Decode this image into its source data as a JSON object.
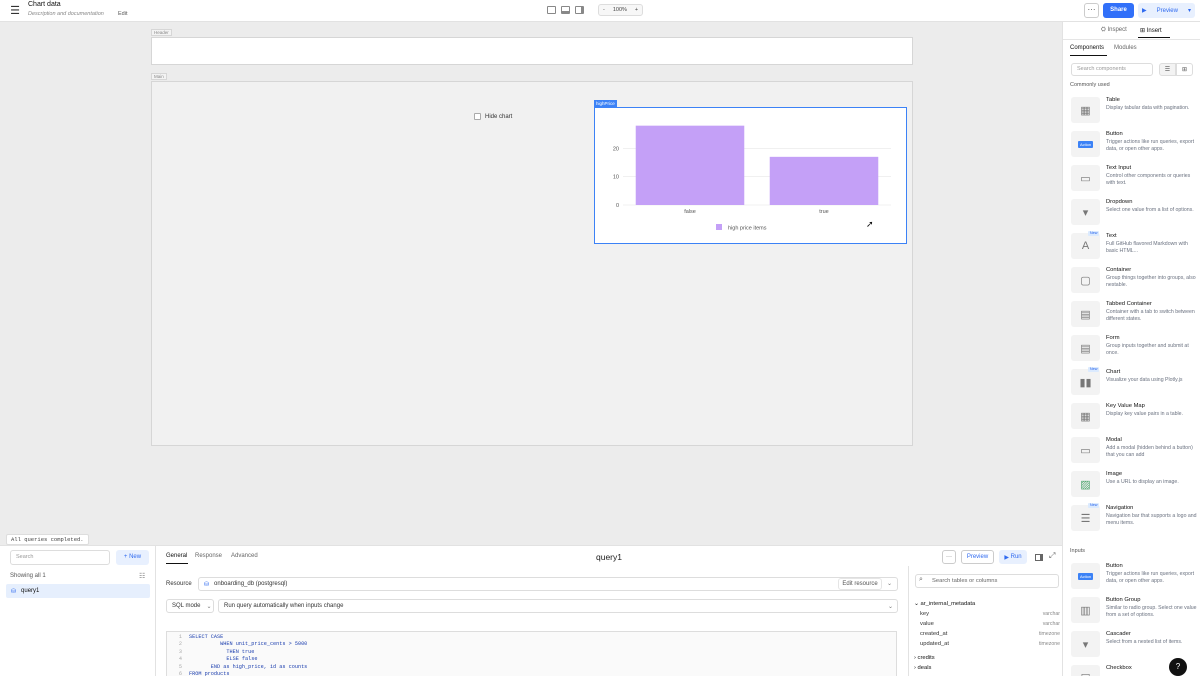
{
  "header": {
    "title": "Chart data",
    "subtitle": "Description and documentation",
    "edit_label": "Edit",
    "zoom": "100%",
    "zoom_minus": "-",
    "zoom_plus": "+",
    "more": "···",
    "share": "Share",
    "preview": "Preview"
  },
  "canvas": {
    "header_tag": "Header",
    "main_tag": "Main",
    "hide_chart_label": "Hide chart",
    "chart_component_tag": "highPrice"
  },
  "chart_data": {
    "type": "bar",
    "categories": [
      "false",
      "true"
    ],
    "series": [
      {
        "name": "high price items",
        "values": [
          28,
          17
        ]
      }
    ],
    "yticks": [
      0,
      10,
      20
    ],
    "ylim": [
      0,
      30
    ],
    "bar_color": "#c4a0f7",
    "grid": true,
    "legend": "bottom"
  },
  "status": "All queries completed.",
  "query_panel": {
    "search_placeholder": "Search",
    "new_label": "+ New",
    "showing": "Showing all 1",
    "queries": [
      "query1"
    ],
    "tabs": [
      "General",
      "Response",
      "Advanced"
    ],
    "query_name": "query1",
    "more": "···",
    "preview": "Preview",
    "run": "Run",
    "resource_label": "Resource",
    "resource_value": "onboarding_db (postgresql)",
    "edit_resource": "Edit resource",
    "mode": "SQL mode",
    "run_mode": "Run query automatically when inputs change",
    "line_numbers": [
      "1",
      "2",
      "3",
      "4",
      "5",
      "6"
    ],
    "code": "SELECT CASE\n          WHEN unit_price_cents > 5000\n            THEN true\n            ELSE false\n       END as high_price, id as counts\nFROM products"
  },
  "schema": {
    "search_placeholder": "Search tables or columns",
    "table": "ar_internal_metadata",
    "columns": [
      {
        "name": "key",
        "type": "varchar"
      },
      {
        "name": "value",
        "type": "varchar"
      },
      {
        "name": "created_at",
        "type": "timezone"
      },
      {
        "name": "updated_at",
        "type": "timezone"
      }
    ],
    "other_tables": [
      "credits",
      "deals"
    ]
  },
  "right_panel": {
    "tab_inspect": "Inspect",
    "tab_insert": "Insert",
    "sub_components": "Components",
    "sub_modules": "Modules",
    "search_placeholder": "Search components",
    "commonly_used": "Commonly used",
    "inputs_label": "Inputs",
    "new_badge": "New",
    "components": [
      {
        "name": "Table",
        "desc": "Display tabular data with pagination."
      },
      {
        "name": "Button",
        "desc": "Trigger actions like run queries, export data, or open other apps."
      },
      {
        "name": "Text Input",
        "desc": "Control other components or queries with text."
      },
      {
        "name": "Dropdown",
        "desc": "Select one value from a list of options."
      },
      {
        "name": "Text",
        "desc": "Full GitHub flavored Markdown with basic HTML..."
      },
      {
        "name": "Container",
        "desc": "Group things together into groups, also nestable."
      },
      {
        "name": "Tabbed Container",
        "desc": "Container with a tab to switch between different states."
      },
      {
        "name": "Form",
        "desc": "Group inputs together and submit at once."
      },
      {
        "name": "Chart",
        "desc": "Visualize your data using Plotly.js"
      },
      {
        "name": "Key Value Map",
        "desc": "Display key value pairs in a table."
      },
      {
        "name": "Modal",
        "desc": "Add a modal (hidden behind a button) that you can add"
      },
      {
        "name": "Image",
        "desc": "Use a URL to display an image."
      },
      {
        "name": "Navigation",
        "desc": "Navigation bar that supports a logo and menu items."
      }
    ],
    "inputs": [
      {
        "name": "Button",
        "desc": "Trigger actions like run queries, export data, or open other apps."
      },
      {
        "name": "Button Group",
        "desc": "Similar to radio group. Select one value from a set of options."
      },
      {
        "name": "Cascader",
        "desc": "Select from a nested list of items."
      },
      {
        "name": "Checkbox",
        "desc": ""
      }
    ],
    "button_thumb_label": "Action",
    "help": "?"
  }
}
